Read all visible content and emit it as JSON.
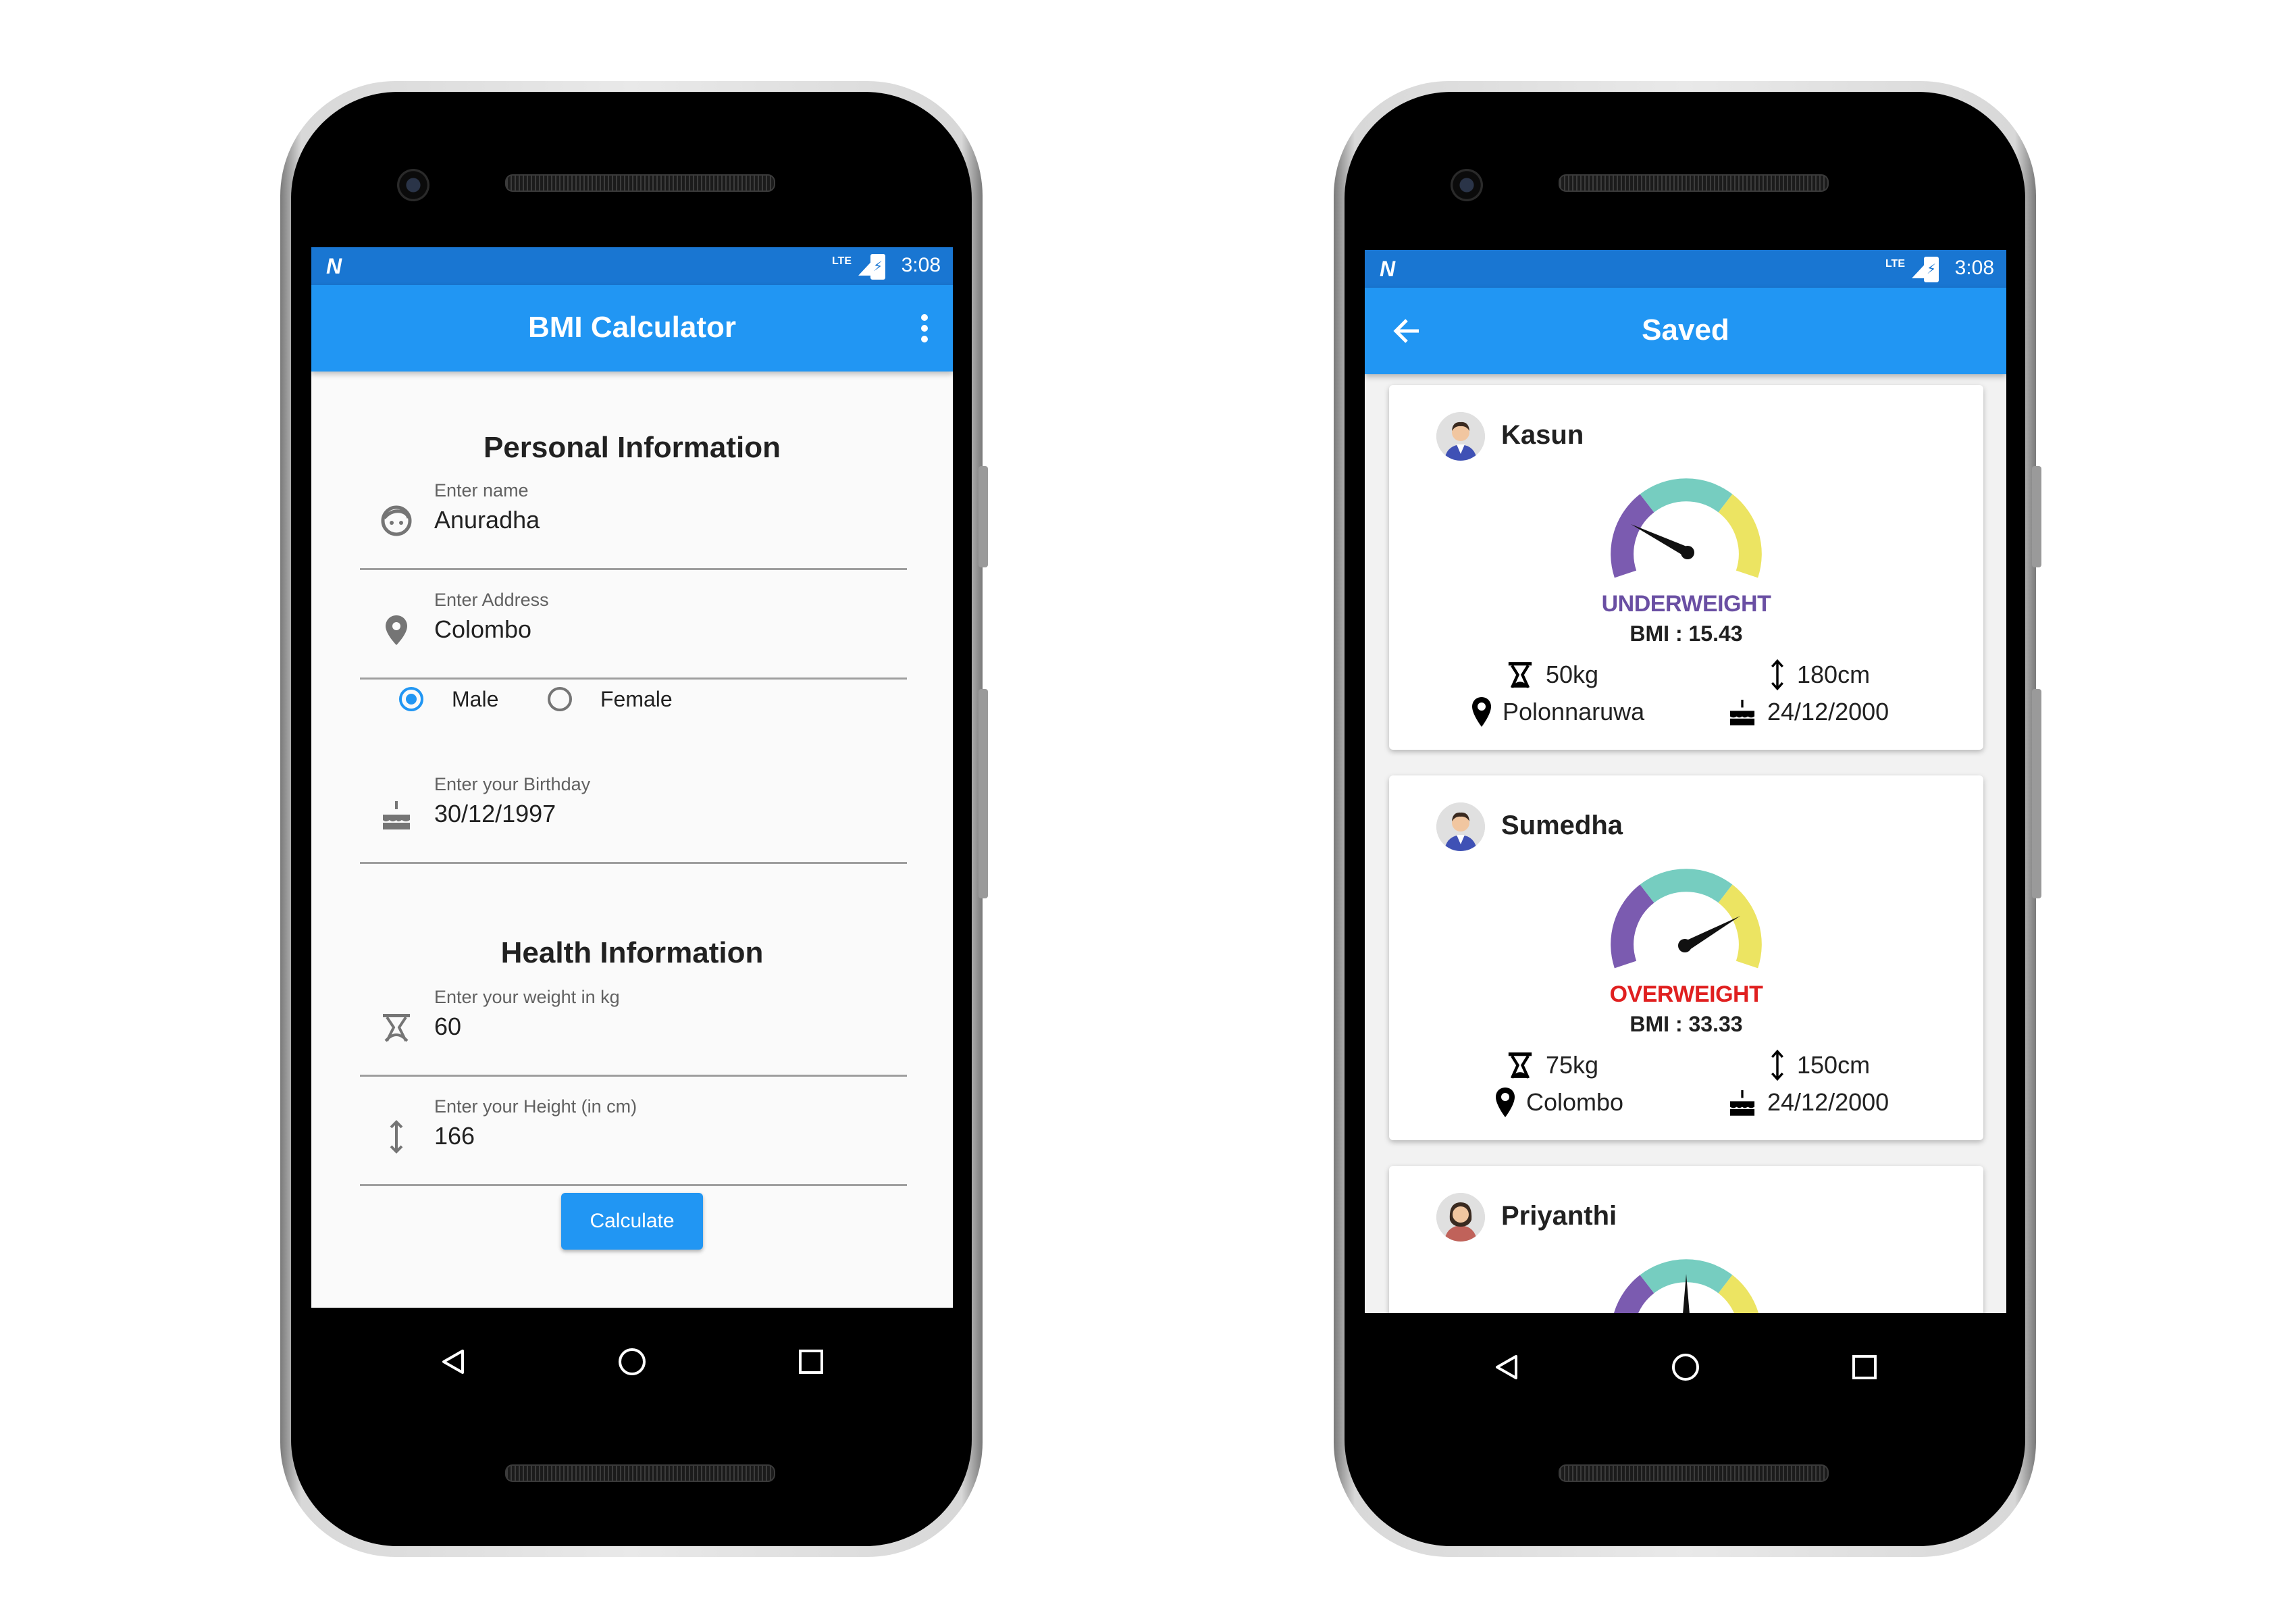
{
  "colors": {
    "primary": "#2196f3",
    "status_bar": "#1976d2",
    "underweight": "#6a4fa3",
    "overweight": "#e02020",
    "gauge_purple": "#7b5bb0",
    "gauge_teal": "#76cdc0",
    "gauge_yellow": "#ece462"
  },
  "left_phone": {
    "status_bar": {
      "time": "3:08",
      "network": "LTE"
    },
    "app_bar": {
      "title": "BMI Calculator",
      "menu_icon": "more-vert-icon"
    },
    "personal_section": {
      "title": "Personal Information",
      "name": {
        "label": "Enter name",
        "value": "Anuradha",
        "icon": "face-icon"
      },
      "address": {
        "label": "Enter Address",
        "value": "Colombo",
        "icon": "location-pin-icon"
      },
      "gender": {
        "options": [
          "Male",
          "Female"
        ],
        "selected": "Male"
      },
      "birthday": {
        "label": "Enter your Birthday",
        "value": "30/12/1997",
        "icon": "cake-icon"
      }
    },
    "health_section": {
      "title": "Health Information",
      "weight": {
        "label": "Enter your weight in kg",
        "value": "60",
        "icon": "scale-icon"
      },
      "height": {
        "label": "Enter your Height (in cm)",
        "value": "166",
        "icon": "height-icon"
      }
    },
    "calculate_button": "Calculate"
  },
  "right_phone": {
    "status_bar": {
      "time": "3:08",
      "network": "LTE"
    },
    "app_bar": {
      "title": "Saved",
      "back_icon": "arrow-back-icon"
    },
    "records": [
      {
        "name": "Kasun",
        "status": "UNDERWEIGHT",
        "bmi": "BMI : 15.43",
        "weight": "50kg",
        "height": "180cm",
        "address": "Polonnaruwa",
        "birthday": "24/12/2000",
        "avatar": "male-avatar-icon"
      },
      {
        "name": "Sumedha",
        "status": "OVERWEIGHT",
        "bmi": "BMI : 33.33",
        "weight": "75kg",
        "height": "150cm",
        "address": "Colombo",
        "birthday": "24/12/2000",
        "avatar": "male-avatar-icon"
      },
      {
        "name": "Priyanthi",
        "avatar": "female-avatar-icon"
      }
    ]
  }
}
